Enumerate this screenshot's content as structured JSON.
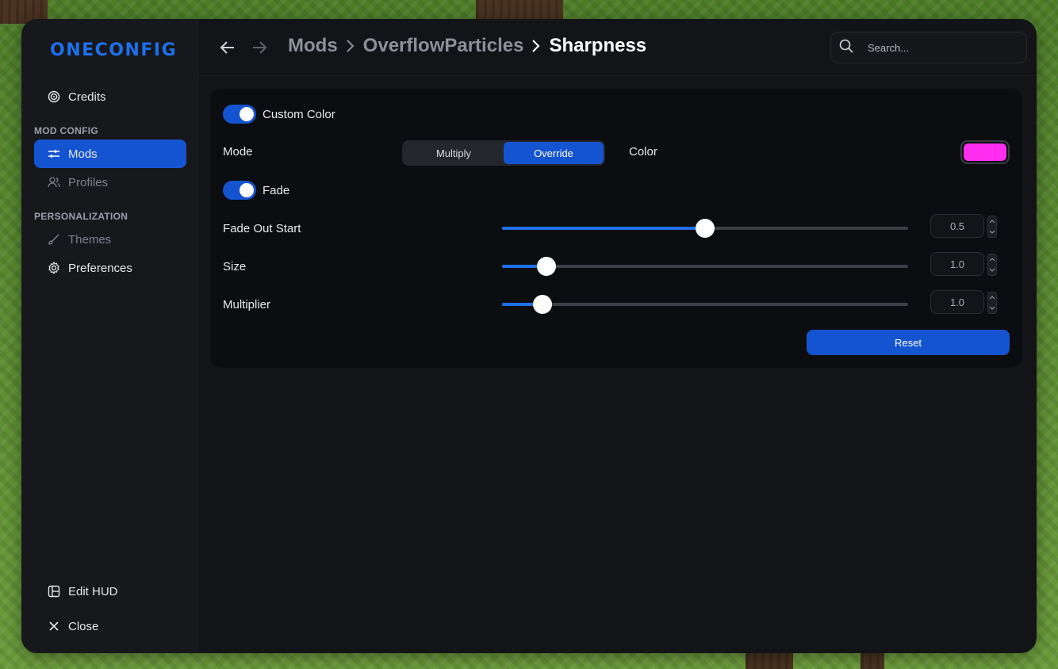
{
  "app": {
    "logo": "ONECONFIG"
  },
  "sidebar": {
    "credits": "Credits",
    "section_mod_config": "MOD CONFIG",
    "mods": "Mods",
    "profiles": "Profiles",
    "section_personalization": "PERSONALIZATION",
    "themes": "Themes",
    "preferences": "Preferences",
    "edit_hud": "Edit HUD",
    "close": "Close"
  },
  "breadcrumb": {
    "items": [
      "Mods",
      "OverflowParticles",
      "Sharpness"
    ]
  },
  "search": {
    "placeholder": "Search..."
  },
  "settings": {
    "custom_color": {
      "label": "Custom Color",
      "enabled": true
    },
    "mode": {
      "label": "Mode",
      "options": [
        "Multiply",
        "Override"
      ],
      "selected": "Override"
    },
    "color": {
      "label": "Color",
      "value": "#ff2df0"
    },
    "fade": {
      "label": "Fade",
      "enabled": true
    },
    "fade_out_start": {
      "label": "Fade Out Start",
      "value": "0.5",
      "fraction": 0.5
    },
    "size": {
      "label": "Size",
      "value": "1.0",
      "fraction": 0.11
    },
    "multiplier": {
      "label": "Multiplier",
      "value": "1.0",
      "fraction": 0.1
    },
    "reset": "Reset"
  },
  "colors": {
    "accent": "#1554d1",
    "window_bg": "#121417",
    "panel_bg": "#0c0d10"
  }
}
